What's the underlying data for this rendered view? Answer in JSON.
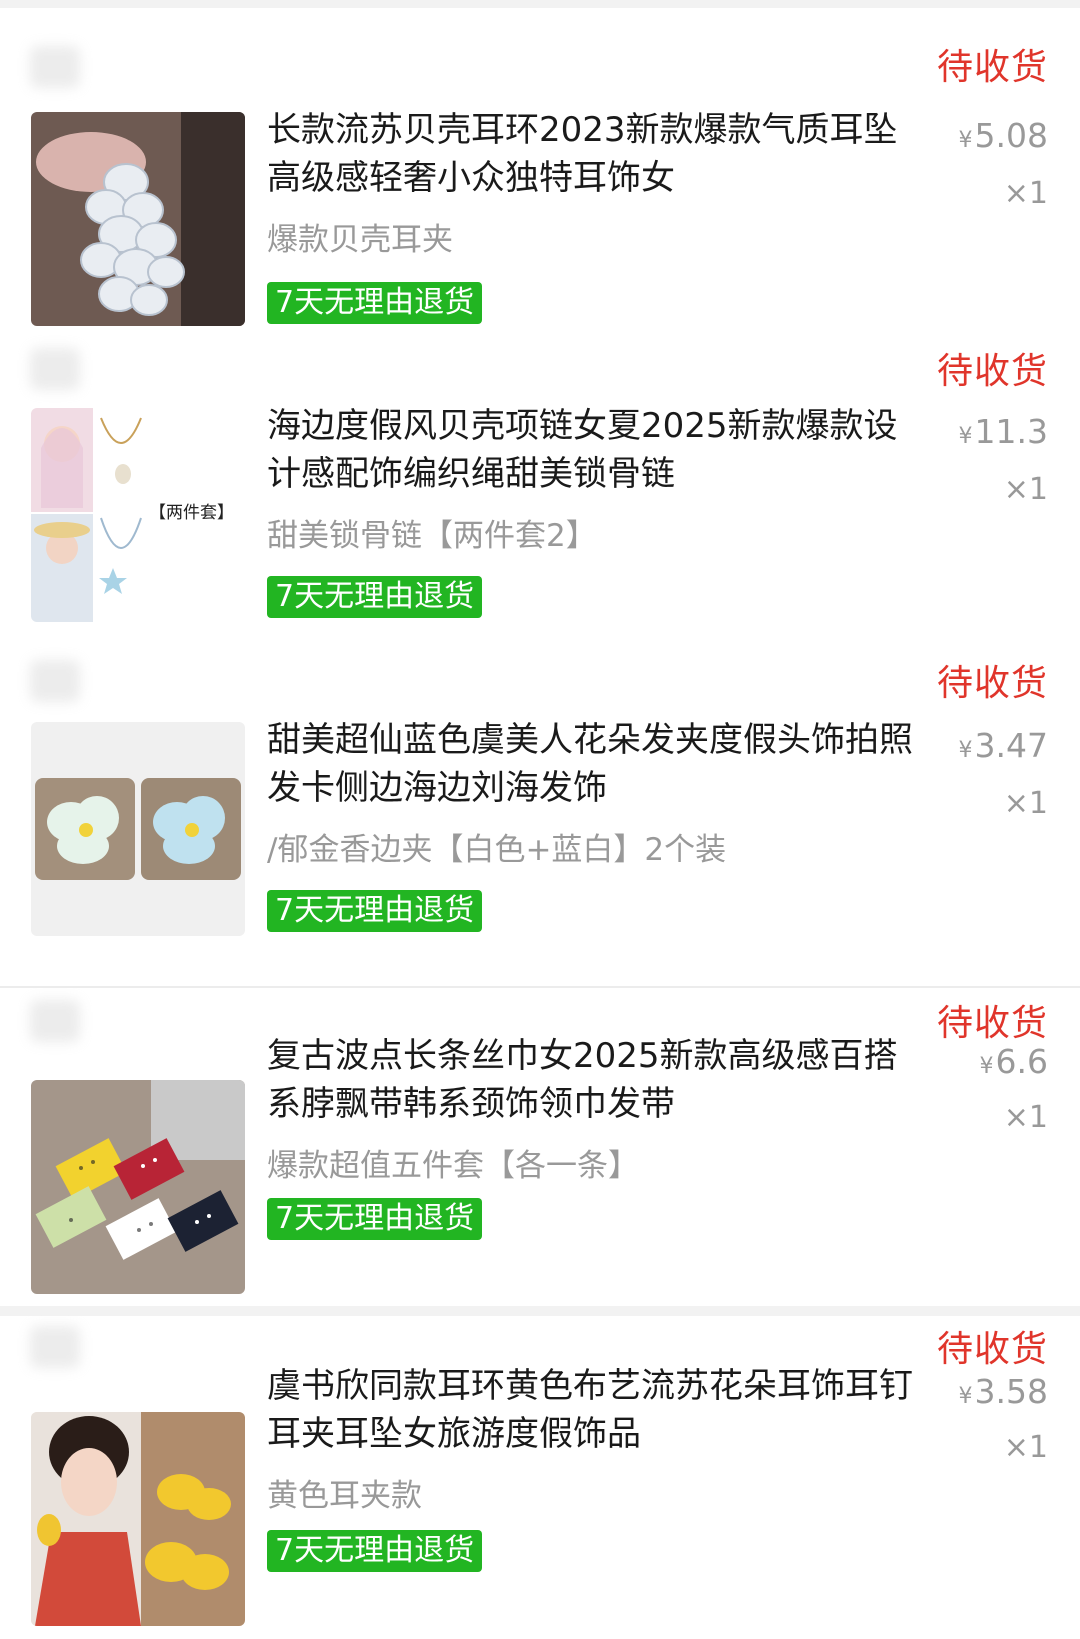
{
  "orders": [
    {
      "status": "待收货",
      "title": "长款流苏贝壳耳环2023新款爆款气质耳坠高级感轻奢小众独特耳饰女",
      "spec": "爆款贝壳耳夹",
      "tag": "7天无理由退货",
      "price_symbol": "¥",
      "price": "5.08",
      "qty": "×1",
      "thumb_icon": "shell-earring-photo"
    },
    {
      "status": "待收货",
      "title": "海边度假风贝壳项链女夏2025新款爆款设计感配饰编织绳甜美锁骨链",
      "spec": "甜美锁骨链【两件套2】",
      "tag": "7天无理由退货",
      "price_symbol": "¥",
      "price": "11.3",
      "qty": "×1",
      "thumb_icon": "necklace-photo",
      "thumb_text": "【两件套】"
    },
    {
      "status": "待收货",
      "title": "甜美超仙蓝色虞美人花朵发夹度假头饰拍照发卡侧边海边刘海发饰",
      "spec": "/郁金香边夹【白色+蓝白】2个装",
      "tag": "7天无理由退货",
      "price_symbol": "¥",
      "price": "3.47",
      "qty": "×1",
      "thumb_icon": "flower-hairclip-photo"
    },
    {
      "status": "待收货",
      "title": "复古波点长条丝巾女2025新款高级感百搭系脖飘带韩系颈饰领巾发带",
      "spec": "爆款超值五件套【各一条】",
      "tag": "7天无理由退货",
      "price_symbol": "¥",
      "price": "6.6",
      "qty": "×1",
      "thumb_icon": "polka-scarf-photo"
    },
    {
      "status": "待收货",
      "title": "虞书欣同款耳环黄色布艺流苏花朵耳饰耳钉耳夹耳坠女旅游度假饰品",
      "spec": "黄色耳夹款",
      "tag": "7天无理由退货",
      "price_symbol": "¥",
      "price": "3.58",
      "qty": "×1",
      "thumb_icon": "yellow-flower-earring-photo"
    }
  ],
  "colors": {
    "status": "#e0352b",
    "tag_bg": "#22b522",
    "muted": "#999999"
  }
}
